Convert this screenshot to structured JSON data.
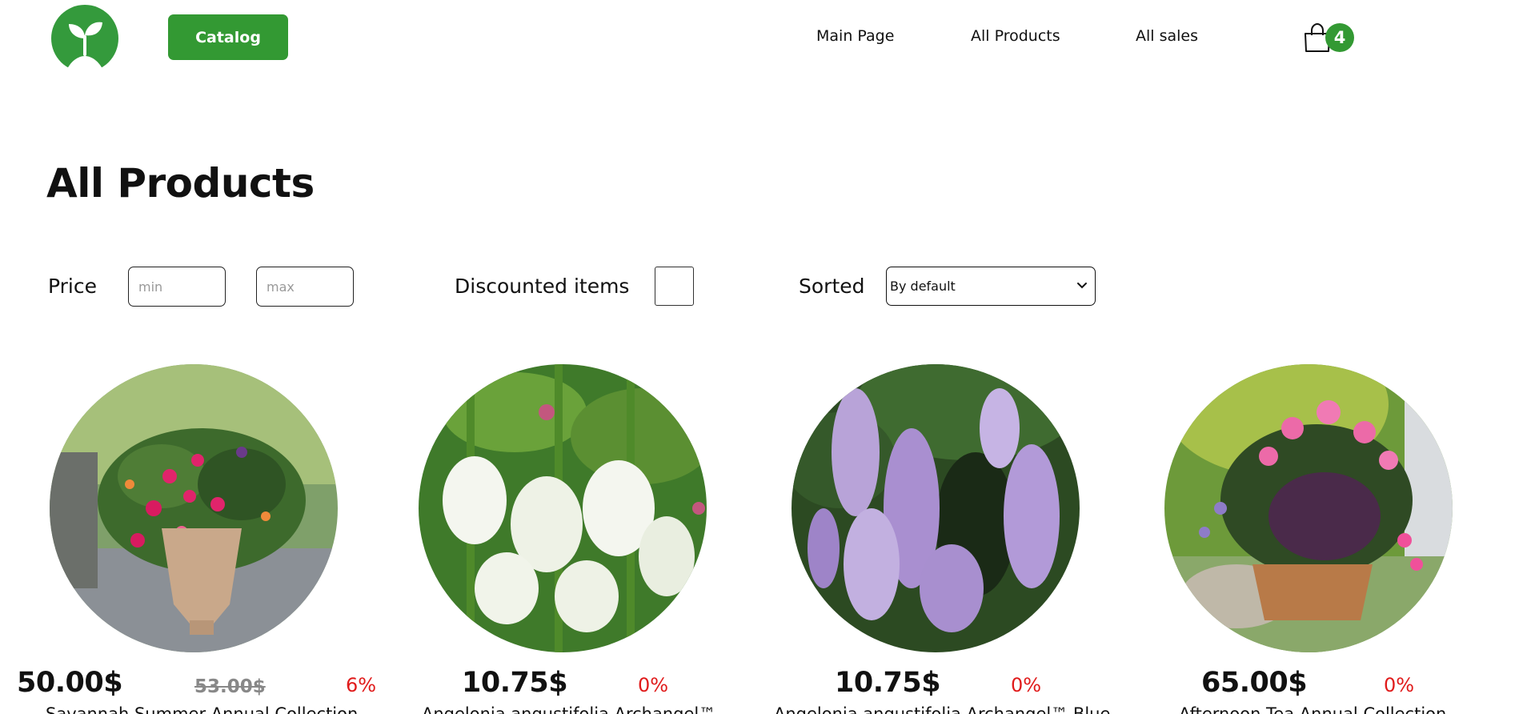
{
  "header": {
    "catalog_label": "Catalog",
    "nav": [
      "Main Page",
      "All Products",
      "All sales"
    ],
    "cart_count": "4",
    "logo_icon": "sprout-logo-icon",
    "cart_icon": "shopping-bag-icon"
  },
  "page_title": "All Products",
  "filters": {
    "price_label": "Price",
    "min_placeholder": "min",
    "max_placeholder": "max",
    "discount_label": "Discounted items",
    "discount_checked": false,
    "sort_label": "Sorted",
    "sort_value": "By default"
  },
  "products": [
    {
      "price": "50.00$",
      "old_price": "53.00$",
      "discount": "6%",
      "name": "Savannah Summer Annual Collection"
    },
    {
      "price": "10.75$",
      "old_price": "",
      "discount": "0%",
      "name": "Angelonia angustifolia Archangel™"
    },
    {
      "price": "10.75$",
      "old_price": "",
      "discount": "0%",
      "name": "Angelonia angustifolia Archangel™ Blue"
    },
    {
      "price": "65.00$",
      "old_price": "",
      "discount": "0%",
      "name": "Afternoon Tea Annual Collection"
    }
  ],
  "colors": {
    "brand_green": "#339933",
    "discount_red": "#e01b1b",
    "old_price_gray": "#888888"
  }
}
